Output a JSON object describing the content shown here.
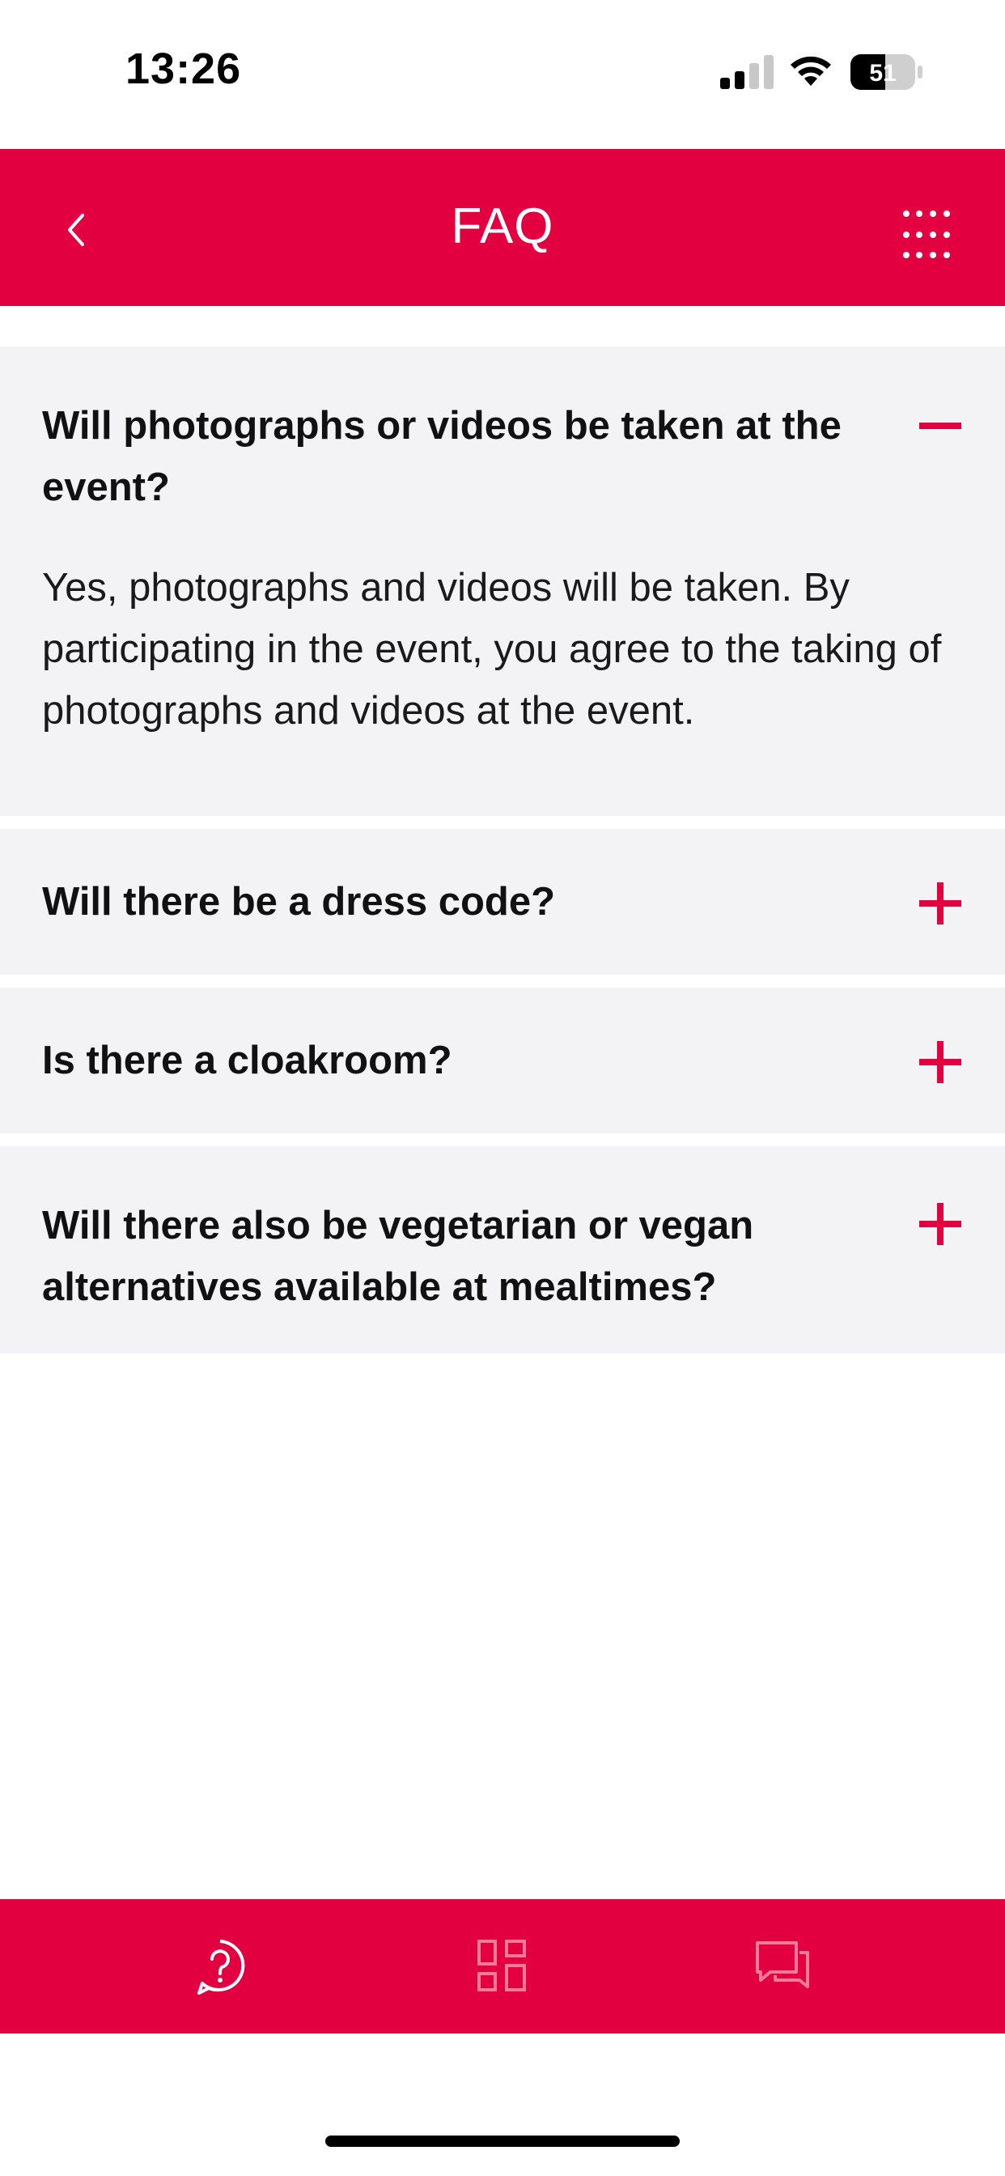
{
  "status_bar": {
    "time": "13:26",
    "battery_level": "51",
    "signal_bars": 2
  },
  "header": {
    "title": "FAQ",
    "back_icon": "chevron-left-icon",
    "menu_icon": "grid-dots-icon"
  },
  "faq": {
    "items": [
      {
        "question": "Will photographs or videos be taken at the event?",
        "answer": "Yes, photographs and videos will be taken. By participating in the event, you agree to the taking of photographs and videos at the event.",
        "expanded": true
      },
      {
        "question": "Will there be a dress code?",
        "expanded": false
      },
      {
        "question": "Is there a cloakroom?",
        "expanded": false
      },
      {
        "question": "Will there also be vegetarian or vegan alternatives available at mealtimes?",
        "expanded": false
      }
    ]
  },
  "bottom_nav": {
    "items": [
      {
        "icon": "help-bubble-icon",
        "active": true
      },
      {
        "icon": "dashboard-grid-icon",
        "active": false
      },
      {
        "icon": "chat-bubbles-icon",
        "active": false
      }
    ]
  },
  "colors": {
    "accent": "#E30041",
    "card_background": "#F3F3F5",
    "text": "#111111"
  }
}
